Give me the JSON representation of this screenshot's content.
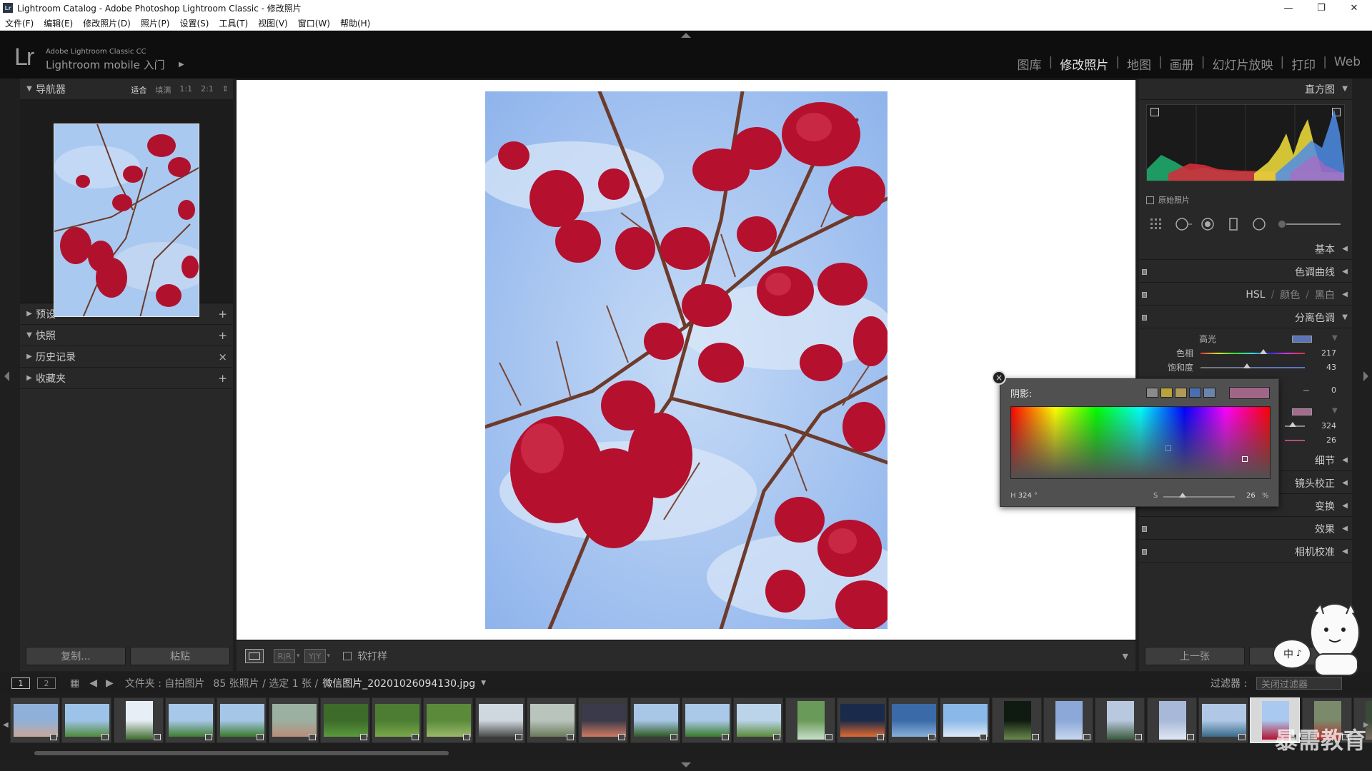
{
  "window": {
    "title": "Lightroom Catalog - Adobe Photoshop Lightroom Classic - 修改照片",
    "app_icon": "Lr",
    "minimize": "—",
    "restore": "❐",
    "close": "✕"
  },
  "menu": [
    "文件(F)",
    "编辑(E)",
    "修改照片(D)",
    "照片(P)",
    "设置(S)",
    "工具(T)",
    "视图(V)",
    "窗口(W)",
    "帮助(H)"
  ],
  "header": {
    "logo": "Lr",
    "product": "Adobe Lightroom Classic CC",
    "subtitle": "Lightroom mobile 入门",
    "modules": [
      {
        "label": "图库",
        "active": false
      },
      {
        "label": "修改照片",
        "active": true
      },
      {
        "label": "地图",
        "active": false
      },
      {
        "label": "画册",
        "active": false
      },
      {
        "label": "幻灯片放映",
        "active": false
      },
      {
        "label": "打印",
        "active": false
      },
      {
        "label": "Web",
        "active": false
      }
    ],
    "separator": "|"
  },
  "left_panel": {
    "navigator": {
      "title": "导航器",
      "zoom": [
        "适合",
        "填满",
        "1:1",
        "2:1"
      ],
      "zoom_active": "适合",
      "zoom_more": "⇕"
    },
    "sections": [
      {
        "label": "预设",
        "action": "+",
        "collapsed": true
      },
      {
        "label": "快照",
        "action": "+",
        "collapsed": false
      },
      {
        "label": "历史记录",
        "action": "×",
        "collapsed": true
      },
      {
        "label": "收藏夹",
        "action": "+",
        "collapsed": true
      }
    ],
    "copy_button": "复制...",
    "paste_button": "粘贴"
  },
  "toolbar": {
    "view_modes": [
      "",
      "R|R",
      "Y|Y"
    ],
    "proof_label": "软打样",
    "more": "▼"
  },
  "right_panel": {
    "histogram_title": "直方图",
    "original_photo_label": "原始照片",
    "panels": {
      "basic": "基本",
      "tone_curve": "色调曲线",
      "hsl": "HSL",
      "hsl_sep": "/",
      "color": "颜色",
      "bw": "黑白",
      "split_toning": "分离色调",
      "detail": "细节",
      "lens": "镜头校正",
      "transform": "变换",
      "effects": "效果",
      "calibration": "相机校准"
    },
    "split": {
      "highlights_label": "高光",
      "hue_label": "色相",
      "hue_value": "217",
      "sat_label": "饱和度",
      "sat_value": "43",
      "balance_value": "0",
      "shadow_hue_value": "324",
      "shadow_sat_value": "26",
      "highlight_swatch": "#5b74b8",
      "shadow_swatch": "#a86a8c"
    },
    "prev_button": "上一张"
  },
  "color_picker": {
    "title": "阴影:",
    "close": "×",
    "swatches": [
      "#8a8a8a",
      "#b8a23c",
      "#b09a5a",
      "#4a6fb0",
      "#6a84ac"
    ],
    "current_color": "#a06688",
    "h_label": "H",
    "h_value": "324",
    "h_unit": "°",
    "s_label": "S",
    "s_value": "26",
    "s_unit": "%"
  },
  "filmstrip": {
    "page1": "1",
    "page2": "2",
    "breadcrumb": "文件夹 : 自拍图片",
    "count": "85 张照片 / 选定 1 张 /",
    "filename": "微信图片_20201026094130.jpg",
    "filename_menu": "▼",
    "filter_label": "过滤器 :",
    "filter_value": "关闭过滤器"
  },
  "mascot": {
    "bubble": "中",
    "decor": "♪"
  },
  "watermark": "暴需教育"
}
